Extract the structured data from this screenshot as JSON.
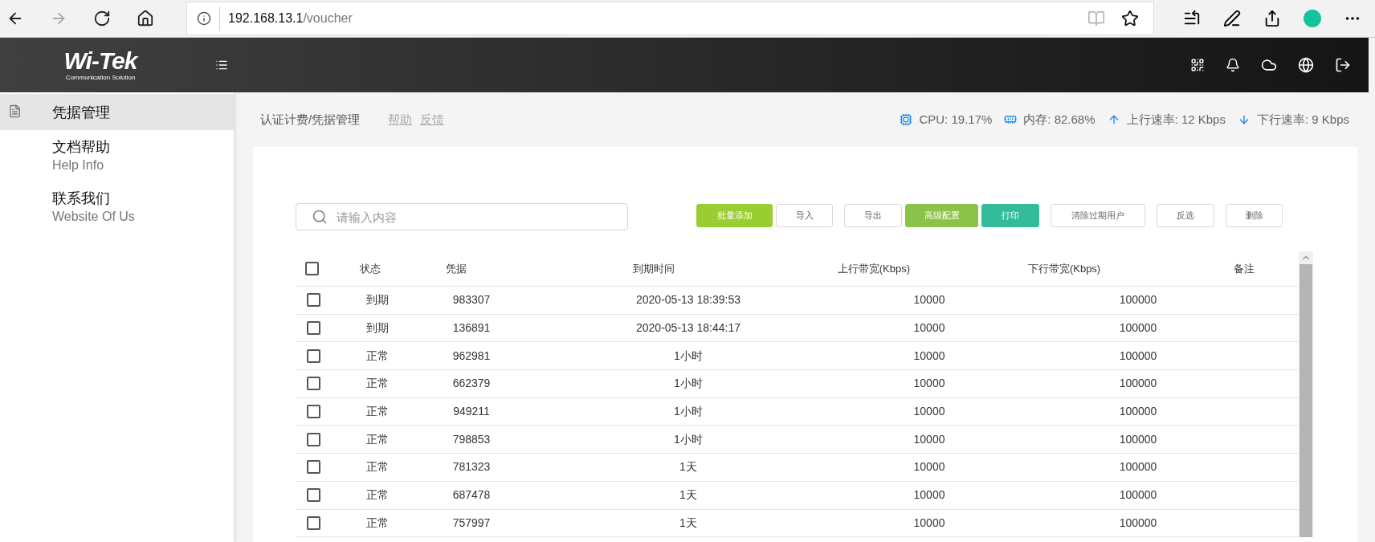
{
  "browser": {
    "url_host": "192.168.13.1",
    "url_path": "/voucher"
  },
  "header": {
    "logo": "Wi-Tek",
    "logo_tagline": "Communication Solution"
  },
  "sidebar": {
    "items": [
      {
        "label": "凭据管理",
        "selected": true
      },
      {
        "label": "文档帮助",
        "sublabel": "Help Info",
        "selected": false
      },
      {
        "label": "联系我们",
        "sublabel": "Website Of Us",
        "selected": false
      }
    ]
  },
  "breadcrumb": "认证计费/凭据管理",
  "links": [
    "帮助",
    "反馈"
  ],
  "stats": [
    {
      "kind": "cpu",
      "text": "CPU: 19.17%"
    },
    {
      "kind": "memory",
      "text": "内存: 82.68%"
    },
    {
      "kind": "up",
      "text": "上行速率: 12 Kbps"
    },
    {
      "kind": "down",
      "text": "下行速率: 9 Kbps"
    }
  ],
  "search": {
    "placeholder": "请输入内容"
  },
  "buttons": [
    {
      "label": "批量添加",
      "kind": "lime"
    },
    {
      "label": "导入",
      "kind": "plain"
    },
    {
      "label": "导出",
      "kind": "plain"
    },
    {
      "label": "高级配置",
      "kind": "green"
    },
    {
      "label": "打印",
      "kind": "teal"
    },
    {
      "label": "清除过期用户",
      "kind": "plain"
    },
    {
      "label": "反选",
      "kind": "plain"
    },
    {
      "label": "删除",
      "kind": "plain"
    }
  ],
  "table": {
    "select_all": {
      "checked": false
    },
    "columns": [
      "状态",
      "凭据",
      "到期时间",
      "上行带宽(Kbps)",
      "下行带宽(Kbps)",
      "备注"
    ],
    "rows": [
      {
        "checked": false,
        "cells": [
          "到期",
          "983307",
          "2020-05-13 18:39:53",
          "10000",
          "100000"
        ]
      },
      {
        "checked": false,
        "cells": [
          "到期",
          "136891",
          "2020-05-13 18:44:17",
          "10000",
          "100000"
        ]
      },
      {
        "checked": false,
        "cells": [
          "正常",
          "962981",
          "1小时",
          "10000",
          "100000"
        ]
      },
      {
        "checked": false,
        "cells": [
          "正常",
          "662379",
          "1小时",
          "10000",
          "100000"
        ]
      },
      {
        "checked": false,
        "cells": [
          "正常",
          "949211",
          "1小时",
          "10000",
          "100000"
        ]
      },
      {
        "checked": false,
        "cells": [
          "正常",
          "798853",
          "1小时",
          "10000",
          "100000"
        ]
      },
      {
        "checked": false,
        "cells": [
          "正常",
          "781323",
          "1天",
          "10000",
          "100000"
        ]
      },
      {
        "checked": false,
        "cells": [
          "正常",
          "687478",
          "1天",
          "10000",
          "100000"
        ]
      },
      {
        "checked": false,
        "cells": [
          "正常",
          "757997",
          "1天",
          "10000",
          "100000"
        ]
      }
    ]
  }
}
